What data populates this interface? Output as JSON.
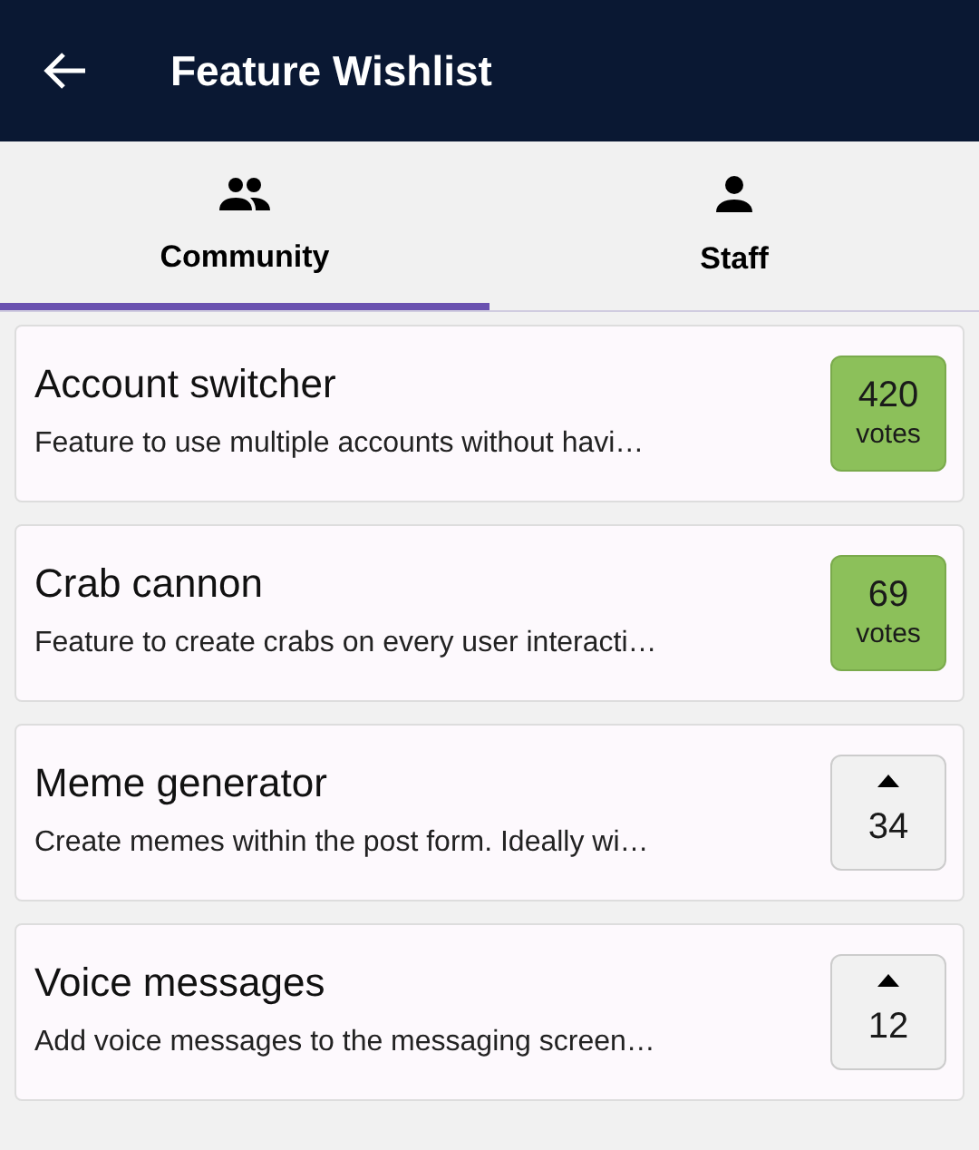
{
  "header": {
    "title": "Feature Wishlist"
  },
  "tabs": [
    {
      "label": "Community",
      "kind": "group",
      "selected": true
    },
    {
      "label": "Staff",
      "kind": "person",
      "selected": false
    }
  ],
  "features": [
    {
      "title": "Account switcher",
      "description": "Feature to use multiple accounts without havi…",
      "count": "420",
      "unit": "votes",
      "voted": true
    },
    {
      "title": "Crab cannon",
      "description": "Feature to create crabs on every user interacti…",
      "count": "69",
      "unit": "votes",
      "voted": true
    },
    {
      "title": "Meme generator",
      "description": "Create memes within the post form. Ideally wi…",
      "count": "34",
      "voted": false
    },
    {
      "title": "Voice messages",
      "description": "Add voice messages to the messaging screen…",
      "count": "12",
      "voted": false
    }
  ]
}
